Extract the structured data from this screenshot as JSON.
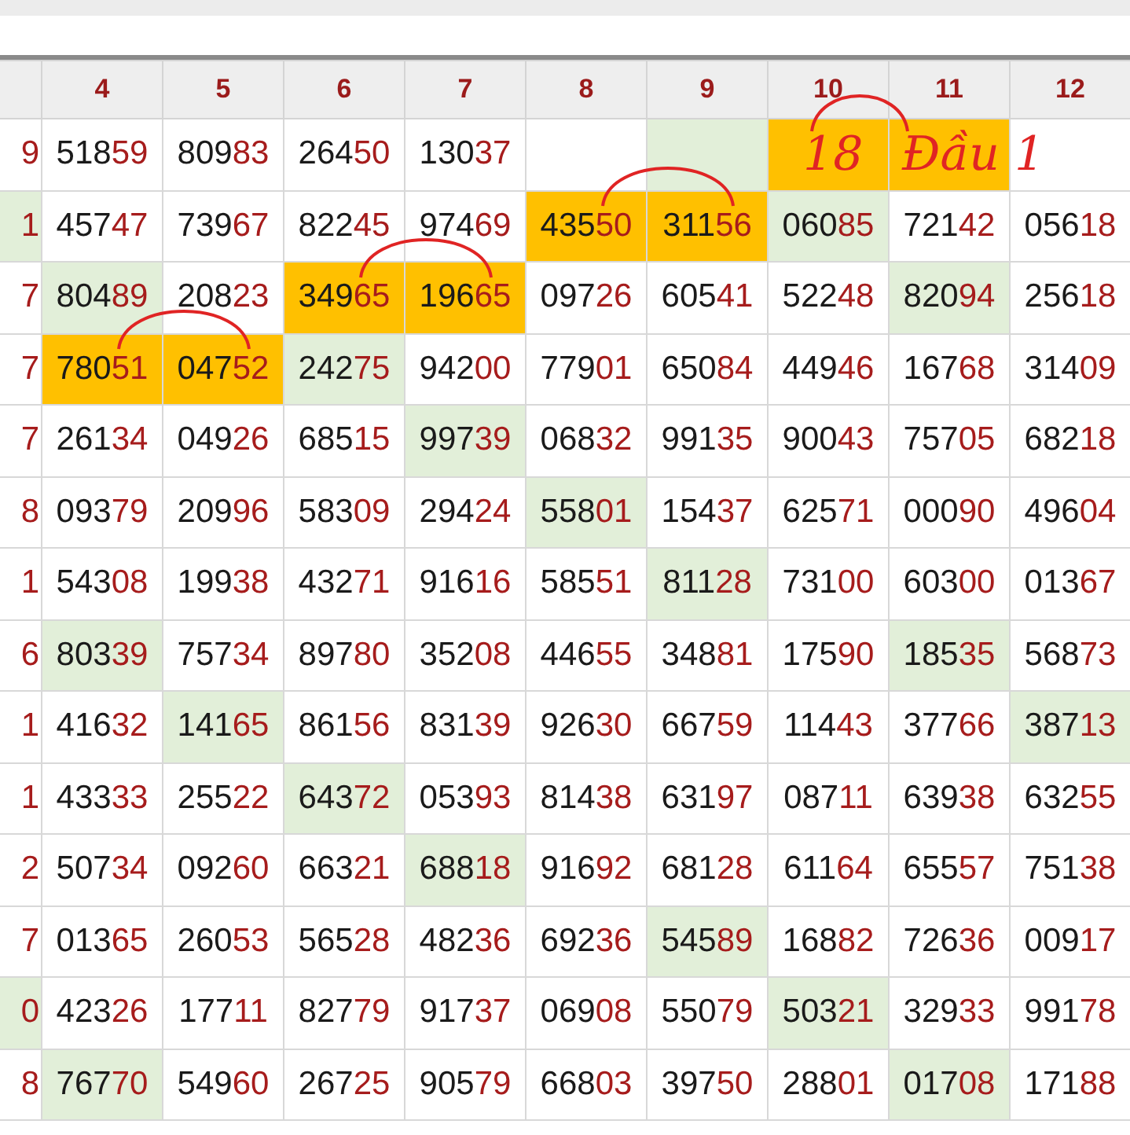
{
  "columns": [
    "",
    "4",
    "5",
    "6",
    "7",
    "8",
    "9",
    "10",
    "11",
    "12"
  ],
  "rows": [
    {
      "cells": [
        {
          "kind": "number",
          "text": "9"
        },
        {
          "kind": "number",
          "text": "51859"
        },
        {
          "kind": "number",
          "text": "80983"
        },
        {
          "kind": "number",
          "text": "26450"
        },
        {
          "kind": "number",
          "text": "13037"
        },
        {
          "kind": "empty"
        },
        {
          "kind": "empty",
          "color": "#e2efd9"
        },
        {
          "kind": "note",
          "text": "18",
          "color": "#ffc000",
          "linked": true
        },
        {
          "kind": "note",
          "text": "Đầu 1",
          "color": "#ffc000",
          "linked": true
        },
        {
          "kind": "empty"
        }
      ]
    },
    {
      "cells": [
        {
          "kind": "number",
          "text": "1",
          "color": "#e2efd9"
        },
        {
          "kind": "number",
          "text": "45747"
        },
        {
          "kind": "number",
          "text": "73967"
        },
        {
          "kind": "number",
          "text": "82245"
        },
        {
          "kind": "number",
          "text": "97469"
        },
        {
          "kind": "number",
          "text": "43550",
          "color": "#ffc000",
          "linked": true
        },
        {
          "kind": "number",
          "text": "31156",
          "color": "#ffc000",
          "linked": true
        },
        {
          "kind": "number",
          "text": "06085",
          "color": "#e2efd9"
        },
        {
          "kind": "number",
          "text": "72142"
        },
        {
          "kind": "number",
          "text": "05618"
        }
      ]
    },
    {
      "cells": [
        {
          "kind": "number",
          "text": "7"
        },
        {
          "kind": "number",
          "text": "80489",
          "color": "#e2efd9"
        },
        {
          "kind": "number",
          "text": "20823"
        },
        {
          "kind": "number",
          "text": "34965",
          "color": "#ffc000",
          "linked": true
        },
        {
          "kind": "number",
          "text": "19665",
          "color": "#ffc000",
          "linked": true
        },
        {
          "kind": "number",
          "text": "09726"
        },
        {
          "kind": "number",
          "text": "60541"
        },
        {
          "kind": "number",
          "text": "52248"
        },
        {
          "kind": "number",
          "text": "82094",
          "color": "#e2efd9"
        },
        {
          "kind": "number",
          "text": "25618"
        }
      ]
    },
    {
      "cells": [
        {
          "kind": "number",
          "text": "7"
        },
        {
          "kind": "number",
          "text": "78051",
          "color": "#ffc000",
          "linked": true
        },
        {
          "kind": "number",
          "text": "04752",
          "color": "#ffc000",
          "linked": true
        },
        {
          "kind": "number",
          "text": "24275",
          "color": "#e2efd9"
        },
        {
          "kind": "number",
          "text": "94200"
        },
        {
          "kind": "number",
          "text": "77901"
        },
        {
          "kind": "number",
          "text": "65084"
        },
        {
          "kind": "number",
          "text": "44946"
        },
        {
          "kind": "number",
          "text": "16768"
        },
        {
          "kind": "number",
          "text": "31409"
        }
      ]
    },
    {
      "cells": [
        {
          "kind": "number",
          "text": "7"
        },
        {
          "kind": "number",
          "text": "26134"
        },
        {
          "kind": "number",
          "text": "04926"
        },
        {
          "kind": "number",
          "text": "68515"
        },
        {
          "kind": "number",
          "text": "99739",
          "color": "#e2efd9"
        },
        {
          "kind": "number",
          "text": "06832"
        },
        {
          "kind": "number",
          "text": "99135"
        },
        {
          "kind": "number",
          "text": "90043"
        },
        {
          "kind": "number",
          "text": "75705"
        },
        {
          "kind": "number",
          "text": "68218"
        }
      ]
    },
    {
      "cells": [
        {
          "kind": "number",
          "text": "8"
        },
        {
          "kind": "number",
          "text": "09379"
        },
        {
          "kind": "number",
          "text": "20996"
        },
        {
          "kind": "number",
          "text": "58309"
        },
        {
          "kind": "number",
          "text": "29424"
        },
        {
          "kind": "number",
          "text": "55801",
          "color": "#e2efd9"
        },
        {
          "kind": "number",
          "text": "15437"
        },
        {
          "kind": "number",
          "text": "62571"
        },
        {
          "kind": "number",
          "text": "00090"
        },
        {
          "kind": "number",
          "text": "49604"
        }
      ]
    },
    {
      "cells": [
        {
          "kind": "number",
          "text": "1"
        },
        {
          "kind": "number",
          "text": "54308"
        },
        {
          "kind": "number",
          "text": "19938"
        },
        {
          "kind": "number",
          "text": "43271"
        },
        {
          "kind": "number",
          "text": "91616"
        },
        {
          "kind": "number",
          "text": "58551"
        },
        {
          "kind": "number",
          "text": "81128",
          "color": "#e2efd9"
        },
        {
          "kind": "number",
          "text": "73100"
        },
        {
          "kind": "number",
          "text": "60300"
        },
        {
          "kind": "number",
          "text": "01367"
        }
      ]
    },
    {
      "cells": [
        {
          "kind": "number",
          "text": "6"
        },
        {
          "kind": "number",
          "text": "80339",
          "color": "#e2efd9"
        },
        {
          "kind": "number",
          "text": "75734"
        },
        {
          "kind": "number",
          "text": "89780"
        },
        {
          "kind": "number",
          "text": "35208"
        },
        {
          "kind": "number",
          "text": "44655"
        },
        {
          "kind": "number",
          "text": "34881"
        },
        {
          "kind": "number",
          "text": "17590"
        },
        {
          "kind": "number",
          "text": "18535",
          "color": "#e2efd9"
        },
        {
          "kind": "number",
          "text": "56873"
        }
      ]
    },
    {
      "cells": [
        {
          "kind": "number",
          "text": "1"
        },
        {
          "kind": "number",
          "text": "41632"
        },
        {
          "kind": "number",
          "text": "14165",
          "color": "#e2efd9"
        },
        {
          "kind": "number",
          "text": "86156"
        },
        {
          "kind": "number",
          "text": "83139"
        },
        {
          "kind": "number",
          "text": "92630"
        },
        {
          "kind": "number",
          "text": "66759"
        },
        {
          "kind": "number",
          "text": "11443"
        },
        {
          "kind": "number",
          "text": "37766"
        },
        {
          "kind": "number",
          "text": "38713",
          "color": "#e2efd9"
        }
      ]
    },
    {
      "cells": [
        {
          "kind": "number",
          "text": "1"
        },
        {
          "kind": "number",
          "text": "43333"
        },
        {
          "kind": "number",
          "text": "25522"
        },
        {
          "kind": "number",
          "text": "64372",
          "color": "#e2efd9"
        },
        {
          "kind": "number",
          "text": "05393"
        },
        {
          "kind": "number",
          "text": "81438"
        },
        {
          "kind": "number",
          "text": "63197"
        },
        {
          "kind": "number",
          "text": "08711"
        },
        {
          "kind": "number",
          "text": "63938"
        },
        {
          "kind": "number",
          "text": "63255"
        }
      ]
    },
    {
      "cells": [
        {
          "kind": "number",
          "text": "2"
        },
        {
          "kind": "number",
          "text": "50734"
        },
        {
          "kind": "number",
          "text": "09260"
        },
        {
          "kind": "number",
          "text": "66321"
        },
        {
          "kind": "number",
          "text": "68818",
          "color": "#e2efd9"
        },
        {
          "kind": "number",
          "text": "91692"
        },
        {
          "kind": "number",
          "text": "68128"
        },
        {
          "kind": "number",
          "text": "61164"
        },
        {
          "kind": "number",
          "text": "65557"
        },
        {
          "kind": "number",
          "text": "75138"
        }
      ]
    },
    {
      "cells": [
        {
          "kind": "number",
          "text": "7"
        },
        {
          "kind": "number",
          "text": "01365"
        },
        {
          "kind": "number",
          "text": "26053"
        },
        {
          "kind": "number",
          "text": "56528"
        },
        {
          "kind": "number",
          "text": "48236"
        },
        {
          "kind": "number",
          "text": "69236"
        },
        {
          "kind": "number",
          "text": "54589",
          "color": "#e2efd9"
        },
        {
          "kind": "number",
          "text": "16882"
        },
        {
          "kind": "number",
          "text": "72636"
        },
        {
          "kind": "number",
          "text": "00917"
        }
      ]
    },
    {
      "cells": [
        {
          "kind": "number",
          "text": "0",
          "color": "#e2efd9"
        },
        {
          "kind": "number",
          "text": "42326"
        },
        {
          "kind": "number",
          "text": "17711"
        },
        {
          "kind": "number",
          "text": "82779"
        },
        {
          "kind": "number",
          "text": "91737"
        },
        {
          "kind": "number",
          "text": "06908"
        },
        {
          "kind": "number",
          "text": "55079"
        },
        {
          "kind": "number",
          "text": "50321",
          "color": "#e2efd9"
        },
        {
          "kind": "number",
          "text": "32933"
        },
        {
          "kind": "number",
          "text": "99178"
        }
      ]
    },
    {
      "cells": [
        {
          "kind": "number",
          "text": "8"
        },
        {
          "kind": "number",
          "text": "76770",
          "color": "#e2efd9"
        },
        {
          "kind": "number",
          "text": "54960"
        },
        {
          "kind": "number",
          "text": "26725"
        },
        {
          "kind": "number",
          "text": "90579"
        },
        {
          "kind": "number",
          "text": "66803"
        },
        {
          "kind": "number",
          "text": "39750"
        },
        {
          "kind": "number",
          "text": "28801"
        },
        {
          "kind": "number",
          "text": "01708",
          "color": "#e2efd9"
        },
        {
          "kind": "number",
          "text": "17188"
        }
      ]
    }
  ]
}
